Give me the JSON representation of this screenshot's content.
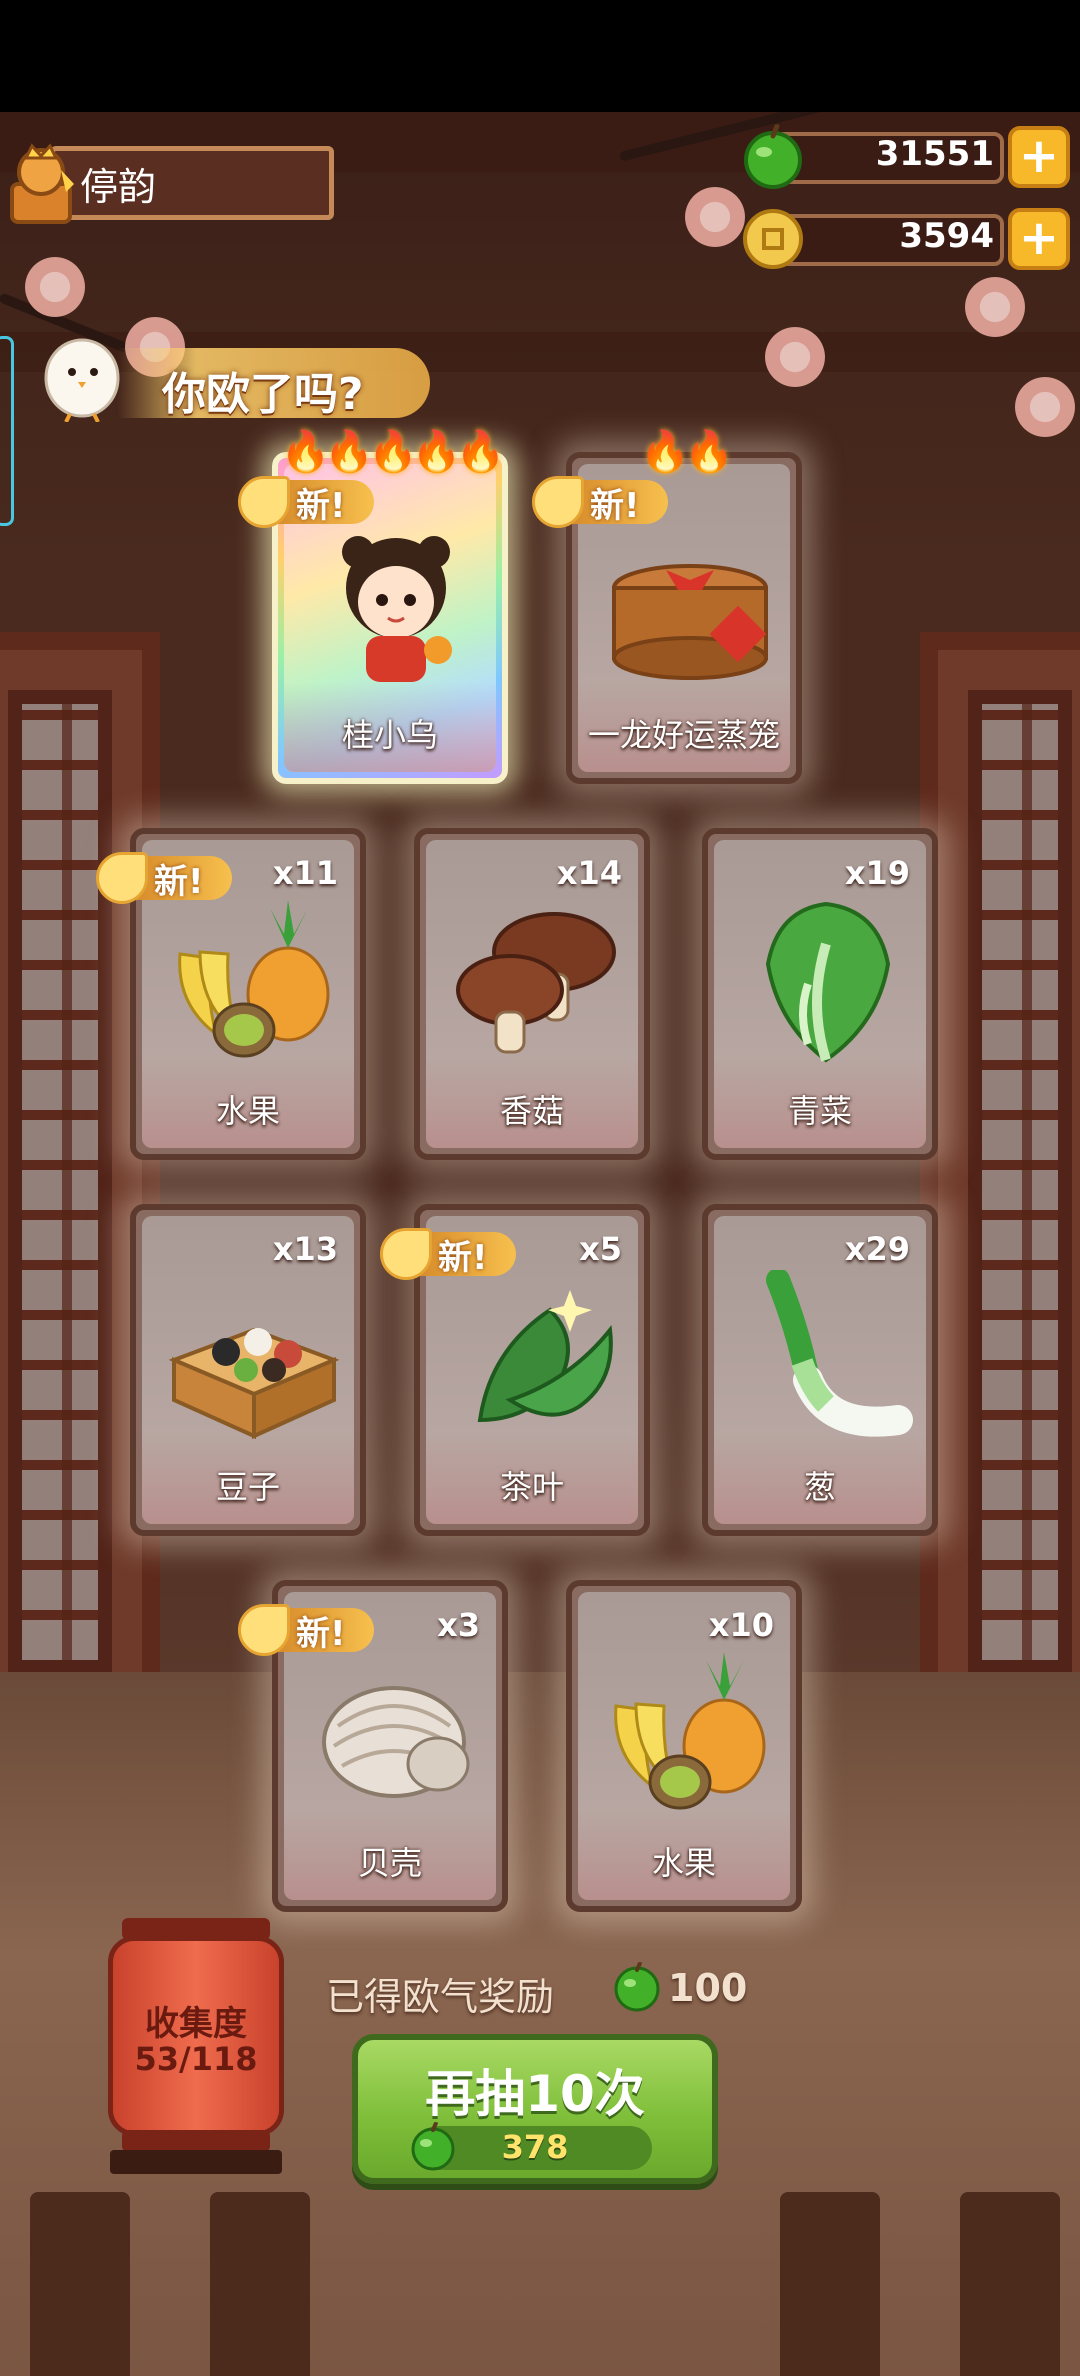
{
  "player": {
    "name": "停韵"
  },
  "currency": {
    "green_apples": "31551",
    "coins": "3594",
    "plus_symbol": "+"
  },
  "banner": {
    "text": "你欧了吗?"
  },
  "cards": [
    {
      "label": "桂小乌",
      "count": "",
      "is_new": true,
      "flames": "5",
      "rarity": "rainbow",
      "art": "girl-character-icon"
    },
    {
      "label": "一龙好运蒸笼",
      "count": "",
      "is_new": true,
      "flames": "2",
      "rarity": "normal",
      "art": "steamer-basket-icon"
    },
    {
      "label": "水果",
      "count": "x11",
      "is_new": true,
      "flames": "0",
      "rarity": "normal",
      "art": "fruit-icon"
    },
    {
      "label": "香菇",
      "count": "x14",
      "is_new": false,
      "flames": "0",
      "rarity": "normal",
      "art": "mushroom-icon"
    },
    {
      "label": "青菜",
      "count": "x19",
      "is_new": false,
      "flames": "0",
      "rarity": "normal",
      "art": "bok-choy-icon"
    },
    {
      "label": "豆子",
      "count": "x13",
      "is_new": false,
      "flames": "0",
      "rarity": "normal",
      "art": "beans-box-icon"
    },
    {
      "label": "茶叶",
      "count": "x5",
      "is_new": true,
      "flames": "0",
      "rarity": "normal",
      "art": "tea-leaves-icon"
    },
    {
      "label": "葱",
      "count": "x29",
      "is_new": false,
      "flames": "0",
      "rarity": "normal",
      "art": "scallion-icon"
    },
    {
      "label": "贝壳",
      "count": "x3",
      "is_new": true,
      "flames": "0",
      "rarity": "normal",
      "art": "clam-icon"
    },
    {
      "label": "水果",
      "count": "x10",
      "is_new": false,
      "flames": "0",
      "rarity": "normal",
      "art": "fruit-icon"
    }
  ],
  "new_tag": {
    "text": "新",
    "exclaim": "!"
  },
  "collection": {
    "title": "收集度",
    "value": "53/118"
  },
  "reward": {
    "label": "已得欧气奖励",
    "value": "100"
  },
  "draw_again": {
    "label": "再抽10次",
    "cost": "378"
  },
  "colors": {
    "accent_gold": "#f7b92a",
    "green_button": "#7fbf3a",
    "lantern_red": "#e0553c",
    "flame": "#ff6a1a"
  }
}
